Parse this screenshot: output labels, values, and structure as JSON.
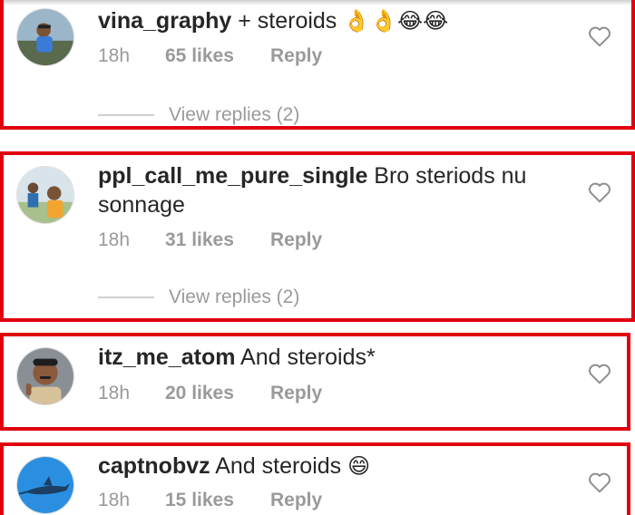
{
  "comments": [
    {
      "username": "vina_graphy",
      "text": " + steroids",
      "emojis": "👌👌😂😂",
      "time": "18h",
      "likes": "65 likes",
      "reply": "Reply",
      "view_replies": "View replies (2)"
    },
    {
      "username": "ppl_call_me_pure_single",
      "text": " Bro steriods nu sonnage",
      "time": "18h",
      "likes": "31 likes",
      "reply": "Reply",
      "view_replies": "View replies (2)"
    },
    {
      "username": "itz_me_atom",
      "text": " And steroids*",
      "time": "18h",
      "likes": "20 likes",
      "reply": "Reply"
    },
    {
      "username": "captnobvz",
      "text": " And steroids",
      "emojis": "😄",
      "time": "18h",
      "likes": "15 likes",
      "reply": "Reply"
    }
  ],
  "colors": {
    "highlight": "#e0000f",
    "meta": "#9a9a9a",
    "text": "#262626"
  },
  "icons": {
    "like": "heart-outline-icon"
  }
}
